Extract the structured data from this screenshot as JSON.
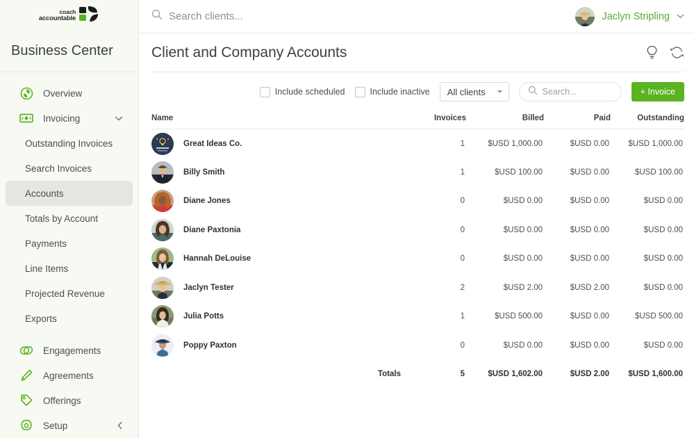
{
  "sidebar": {
    "logo": {
      "line1": "coach",
      "line2": "accountable",
      "icon": "leaf-logo-icon"
    },
    "title": "Business Center",
    "items": [
      {
        "label": "Overview",
        "icon": "overview-leaf-icon",
        "type": "top",
        "active": false,
        "chevron": ""
      },
      {
        "label": "Invoicing",
        "icon": "invoicing-money-icon",
        "type": "top",
        "active": false,
        "chevron": "v"
      },
      {
        "label": "Outstanding Invoices",
        "icon": "",
        "type": "sub",
        "active": false,
        "chevron": ""
      },
      {
        "label": "Search Invoices",
        "icon": "",
        "type": "sub",
        "active": false,
        "chevron": ""
      },
      {
        "label": "Accounts",
        "icon": "",
        "type": "sub",
        "active": true,
        "chevron": ""
      },
      {
        "label": "Totals by Account",
        "icon": "",
        "type": "sub",
        "active": false,
        "chevron": ""
      },
      {
        "label": "Payments",
        "icon": "",
        "type": "sub",
        "active": false,
        "chevron": ""
      },
      {
        "label": "Line Items",
        "icon": "",
        "type": "sub",
        "active": false,
        "chevron": ""
      },
      {
        "label": "Projected Revenue",
        "icon": "",
        "type": "sub",
        "active": false,
        "chevron": ""
      },
      {
        "label": "Exports",
        "icon": "",
        "type": "sub",
        "active": false,
        "chevron": ""
      },
      {
        "label": "Engagements",
        "icon": "engagements-rings-icon",
        "type": "top",
        "active": false,
        "chevron": ""
      },
      {
        "label": "Agreements",
        "icon": "agreements-pen-icon",
        "type": "top",
        "active": false,
        "chevron": ""
      },
      {
        "label": "Offerings",
        "icon": "offerings-tag-icon",
        "type": "top",
        "active": false,
        "chevron": ""
      },
      {
        "label": "Setup",
        "icon": "setup-gear-icon",
        "type": "top",
        "active": false,
        "chevron": "<"
      }
    ]
  },
  "topbar": {
    "search_placeholder": "Search clients...",
    "user_name": "Jaclyn Stripling"
  },
  "page": {
    "title": "Client and Company Accounts",
    "icons": [
      "lightbulb-icon",
      "refresh-icon"
    ]
  },
  "filters": {
    "include_scheduled_label": "Include scheduled",
    "include_scheduled_checked": false,
    "include_inactive_label": "Include inactive",
    "include_inactive_checked": false,
    "client_filter_value": "All clients",
    "search_placeholder": "Search...",
    "search_value": "",
    "invoice_button_label": "+ Invoice"
  },
  "table": {
    "headers": [
      "Name",
      "Invoices",
      "Billed",
      "Paid",
      "Outstanding"
    ],
    "rows": [
      {
        "name": "Great Ideas Co.",
        "avatar": "company-bulb",
        "invoices": "1",
        "billed": "$USD 1,000.00",
        "paid": "$USD 0.00",
        "outstanding": "$USD 1,000.00"
      },
      {
        "name": "Billy Smith",
        "avatar": "man-suit",
        "invoices": "1",
        "billed": "$USD 100.00",
        "paid": "$USD 0.00",
        "outstanding": "$USD 100.00"
      },
      {
        "name": "Diane Jones",
        "avatar": "woman-red",
        "invoices": "0",
        "billed": "$USD 0.00",
        "paid": "$USD 0.00",
        "outstanding": "$USD 0.00"
      },
      {
        "name": "Diane Paxtonia",
        "avatar": "woman-teal",
        "invoices": "0",
        "billed": "$USD 0.00",
        "paid": "$USD 0.00",
        "outstanding": "$USD 0.00"
      },
      {
        "name": "Hannah DeLouise",
        "avatar": "woman-green",
        "invoices": "0",
        "billed": "$USD 0.00",
        "paid": "$USD 0.00",
        "outstanding": "$USD 0.00"
      },
      {
        "name": "Jaclyn Tester",
        "avatar": "woman-hat",
        "invoices": "2",
        "billed": "$USD 2.00",
        "paid": "$USD 2.00",
        "outstanding": "$USD 0.00"
      },
      {
        "name": "Julia Potts",
        "avatar": "woman-white",
        "invoices": "1",
        "billed": "$USD 500.00",
        "paid": "$USD 0.00",
        "outstanding": "$USD 500.00"
      },
      {
        "name": "Poppy Paxton",
        "avatar": "person-bluehat",
        "invoices": "0",
        "billed": "$USD 0.00",
        "paid": "$USD 0.00",
        "outstanding": "$USD 0.00"
      }
    ],
    "totals": {
      "label": "Totals",
      "invoices": "5",
      "billed": "$USD 1,602.00",
      "paid": "$USD 2.00",
      "outstanding": "$USD 1,600.00"
    }
  },
  "colors": {
    "brand_green": "#5ab321",
    "sidebar_bg": "#f7faf3",
    "active_item_bg": "#e4e6e0",
    "text_primary": "#3c4043",
    "text_secondary": "#4a4d50"
  }
}
